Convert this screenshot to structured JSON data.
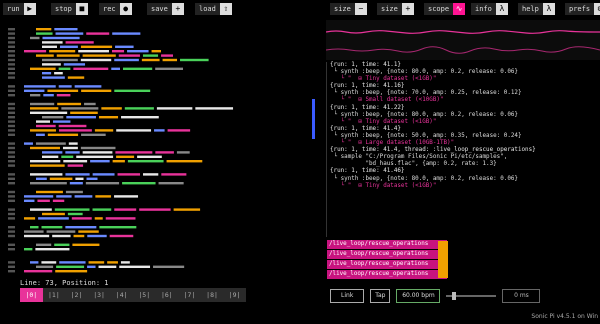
{
  "toolbar": {
    "left": [
      {
        "label": "run",
        "icon": "▶"
      },
      {
        "label": "stop",
        "icon": "■"
      },
      {
        "label": "rec",
        "icon": "●"
      },
      {
        "label": "save",
        "icon": "+"
      },
      {
        "label": "load",
        "icon": "⇧"
      }
    ],
    "right": [
      {
        "label": "size",
        "icon": "−"
      },
      {
        "label": "size",
        "icon": "+"
      },
      {
        "label": "scope",
        "icon": "∿"
      },
      {
        "label": "info",
        "icon": "λ"
      },
      {
        "label": "help",
        "icon": "λ"
      },
      {
        "label": "prefs",
        "icon": "⚙"
      }
    ]
  },
  "status": {
    "line_label": "Line: 73,",
    "position_label": "Position: 1"
  },
  "buffers": [
    "|0|",
    "|1|",
    "|2|",
    "|3|",
    "|4|",
    "|5|",
    "|6|",
    "|7|",
    "|8|",
    "|9|"
  ],
  "active_buffer": 0,
  "log": [
    "{run: 1, time: 41.1}",
    " └ synth :beep, {note: 80.0, amp: 0.2, release: 0.06}",
    "   └ \"  ⊞ Tiny dataset (<1GB)\"",
    "",
    "{run: 1, time: 41.16}",
    " └ synth :beep, {note: 70.0, amp: 0.25, release: 0.12}",
    "   └ \"  ⊞ Small dataset (<10GB)\"",
    "",
    "{run: 1, time: 41.22}",
    " └ synth :beep, {note: 80.0, amp: 0.2, release: 0.06}",
    "   └ \"  ⊞ Tiny dataset (<1GB)\"",
    "",
    "{run: 1, time: 41.4}",
    " └ synth :beep, {note: 50.0, amp: 0.35, release: 0.24}",
    "   └ \"  ⊞ Large dataset (10GB-1TB)\"",
    "",
    "{run: 1, time: 41.4, thread: :live_loop_rescue_operations}",
    " └ sample \"C:/Program Files/Sonic Pi/etc/samples\",",
    "          \"bd_haus.flac\", {amp: 0.2, rate: 1.3}",
    "",
    "{run: 1, time: 41.46}",
    " └ synth :beep, {note: 80.0, amp: 0.2, release: 0.06}",
    "   └ \"  ⊞ Tiny dataset (<1GB)\""
  ],
  "cue": [
    "/live_loop/rescue_operations",
    "/live_loop/rescue_operations",
    "/live_loop/rescue_operations",
    "/live_loop/rescue_operations"
  ],
  "link": {
    "link_label": "Link",
    "tap_label": "Tap",
    "bpm": "60.00 bpm",
    "latency": "0 ms"
  },
  "version": "Sonic Pi v4.5.1 on Win",
  "colors": {
    "accent": "#e8339a",
    "scroll": "#3b5bff",
    "cue_bar": "#f0a000"
  }
}
